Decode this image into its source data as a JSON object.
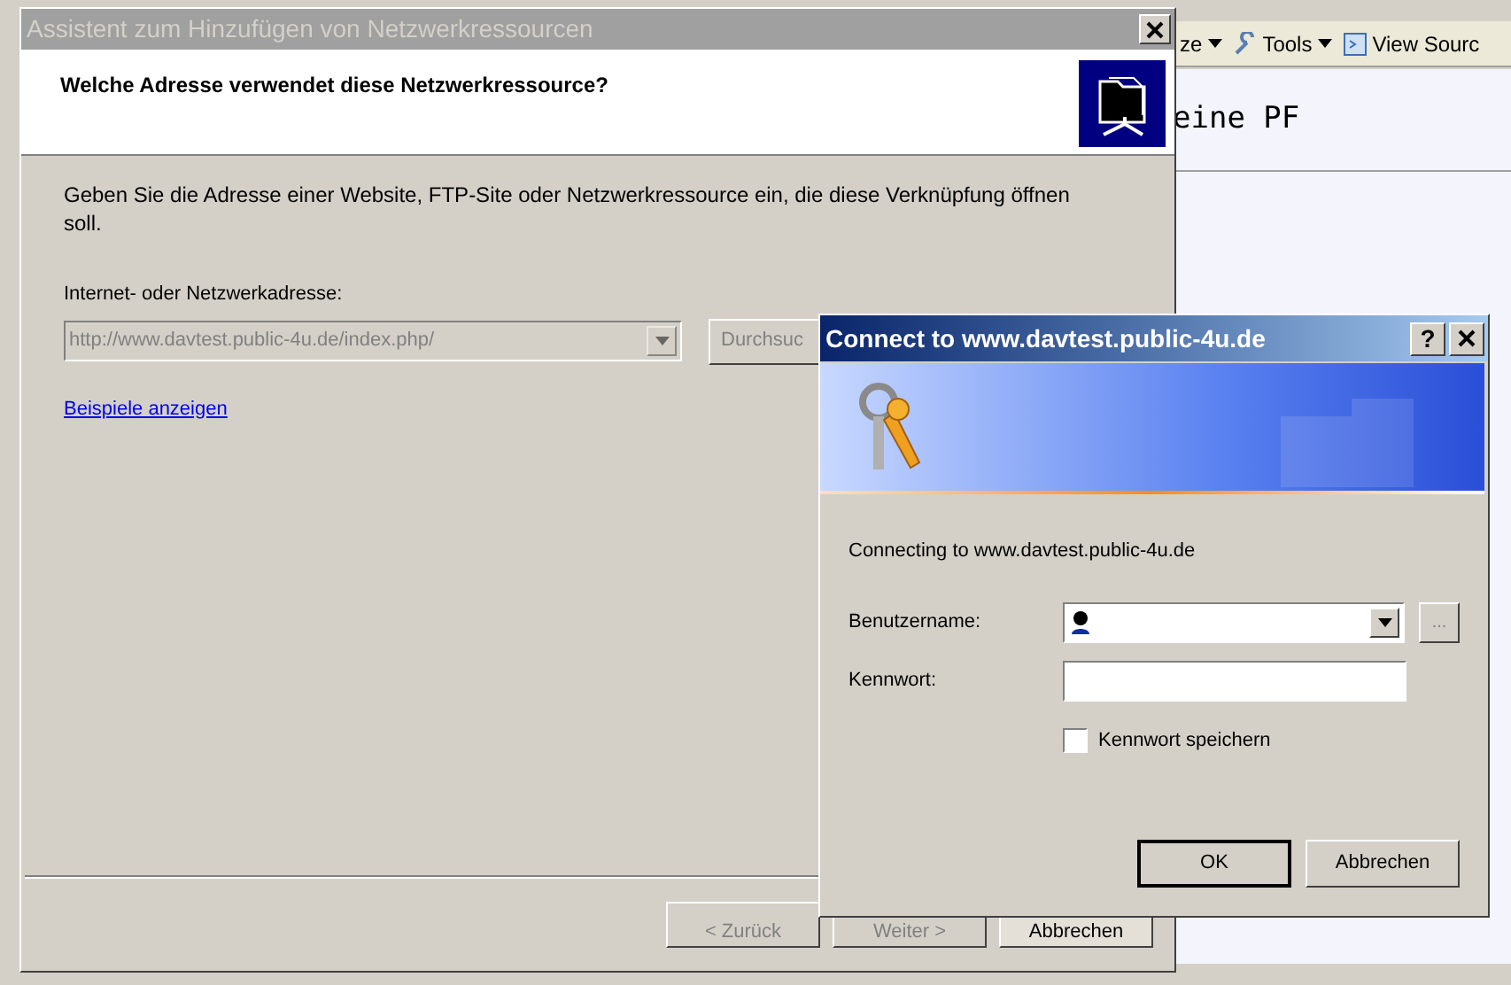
{
  "browser": {
    "toolbar": [
      {
        "label": "ze",
        "kind": "menu"
      },
      {
        "label": "Tools",
        "kind": "menu"
      },
      {
        "label": "View Sourc",
        "kind": "link"
      }
    ],
    "page_heading": "eine PF"
  },
  "wizard": {
    "title": "Assistent zum Hinzufügen von Netzwerkressourcen",
    "active": false,
    "heading": "Welche Adresse verwendet diese Netzwerkressource?",
    "description": "Geben Sie die Adresse einer Website, FTP-Site oder Netzwerkressource ein, die diese Verknüpfung öffnen soll.",
    "address_label": "Internet- oder Netzwerkadresse:",
    "address_value": "http://www.davtest.public-4u.de/index.php/",
    "address_disabled": true,
    "browse_button": "Durchsuc",
    "examples_link": "Beispiele anzeigen",
    "buttons": [
      {
        "label": "< Zurück",
        "disabled": true
      },
      {
        "label": "Weiter >",
        "disabled": true
      },
      {
        "label": "Abbrechen",
        "disabled": false
      }
    ]
  },
  "login_dialog": {
    "title": "Connect to www.davtest.public-4u.de",
    "active": true,
    "help_button": "?",
    "message": "Connecting to www.davtest.public-4u.de",
    "username_label": "Benutzername:",
    "more_button": "...",
    "password_label": "Kennwort:",
    "remember": {
      "label": "Kennwort speichern",
      "checked": false
    },
    "buttons": [
      {
        "label": "OK",
        "default": true
      },
      {
        "label": "Abbrechen",
        "default": false
      }
    ]
  }
}
